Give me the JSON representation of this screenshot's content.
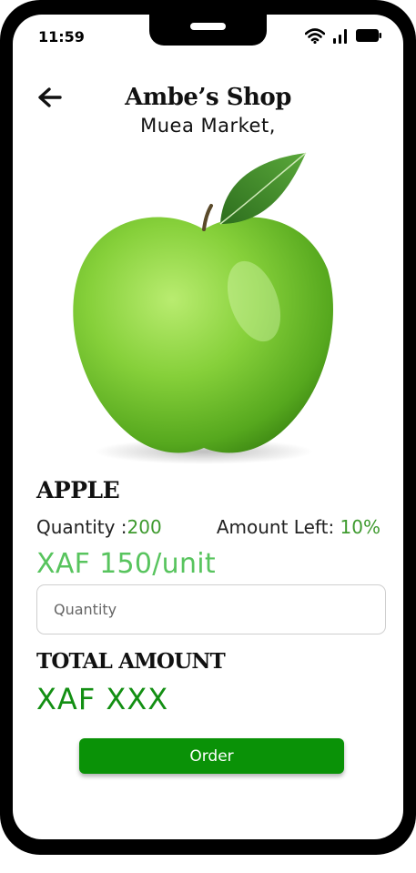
{
  "status_bar": {
    "time": "11:59"
  },
  "header": {
    "shop_name": "Ambe’s Shop",
    "location": "Muea Market,"
  },
  "product": {
    "name": "APPLE",
    "quantity_label": "Quantity :",
    "quantity_value": "200",
    "amount_left_label": "Amount Left:",
    "amount_left_value": "10%",
    "price": "XAF 150/unit",
    "image_icon": "green-apple"
  },
  "order_form": {
    "quantity_placeholder": "Quantity",
    "total_label": "TOTAL AMOUNT",
    "total_value": "XAF XXX",
    "order_label": "Order"
  },
  "colors": {
    "accent": "#0a9207",
    "price": "#58c45e",
    "value": "#3e9a2e",
    "total": "#138f13"
  }
}
